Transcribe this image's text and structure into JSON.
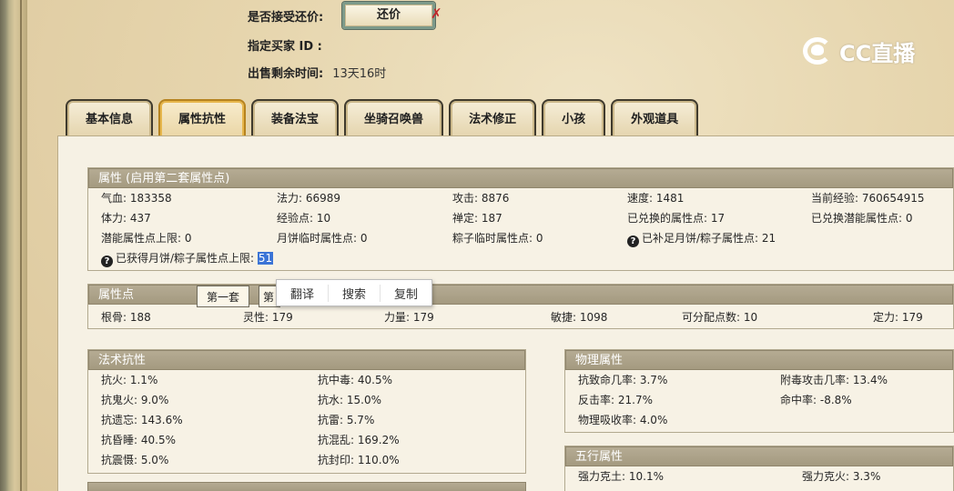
{
  "listing": {
    "accept_bargain_label": "是否接受还价:",
    "bargain_button": "还价",
    "buyer_id_label": "指定买家 ID :",
    "remaining_label": "出售剩余时间:",
    "remaining_value": "13天16时"
  },
  "logo": {
    "text": "CC直播"
  },
  "tabs": [
    {
      "label": "基本信息",
      "active": false
    },
    {
      "label": "属性抗性",
      "active": true
    },
    {
      "label": "装备法宝",
      "active": false
    },
    {
      "label": "坐骑召唤兽",
      "active": false
    },
    {
      "label": "法术修正",
      "active": false
    },
    {
      "label": "小孩",
      "active": false
    },
    {
      "label": "外观道具",
      "active": false
    }
  ],
  "attributes": {
    "title": "属性 (启用第二套属性点)",
    "rows": [
      [
        "气血: 183358",
        "法力: 66989",
        "攻击: 8876",
        "速度: 1481",
        "当前经验: 760654915"
      ],
      [
        "体力: 437",
        "经验点: 10",
        "禅定: 187",
        "已兑换的属性点: 17",
        "已兑换潜能属性点: 0"
      ],
      [
        "潜能属性点上限: 0",
        "月饼临时属性点: 0",
        "粽子临时属性点: 0",
        "已补足月饼/粽子属性点: 21"
      ]
    ],
    "extra_label": "已获得月饼/粽子属性点上限:",
    "extra_value": "51"
  },
  "context_menu": [
    "翻译",
    "搜索",
    "复制"
  ],
  "points": {
    "title": "属性点",
    "subtab_1": "第一套",
    "subtab_2": "第",
    "values": [
      "根骨: 188",
      "灵性: 179",
      "力量: 179",
      "敏捷: 1098",
      "可分配点数: 10",
      "定力: 179"
    ]
  },
  "magic_resist": {
    "title": "法术抗性",
    "rows": [
      [
        "抗火: 1.1%",
        "抗中毒: 40.5%"
      ],
      [
        "抗鬼火: 9.0%",
        "抗水: 15.0%"
      ],
      [
        "抗遗忘: 143.6%",
        "抗雷: 5.7%"
      ],
      [
        "抗昏睡: 40.5%",
        "抗混乱: 169.2%"
      ],
      [
        "抗震慑: 5.0%",
        "抗封印: 110.0%"
      ]
    ]
  },
  "physical": {
    "title": "物理属性",
    "rows": [
      [
        "抗致命几率: 3.7%",
        "附毒攻击几率: 13.4%"
      ],
      [
        "反击率: 21.7%",
        "命中率: -8.8%"
      ],
      [
        "物理吸收率: 4.0%"
      ]
    ]
  },
  "five_elements": {
    "title": "五行属性",
    "rows": [
      [
        "强力克土: 10.1%",
        "强力克火: 3.3%"
      ]
    ]
  }
}
